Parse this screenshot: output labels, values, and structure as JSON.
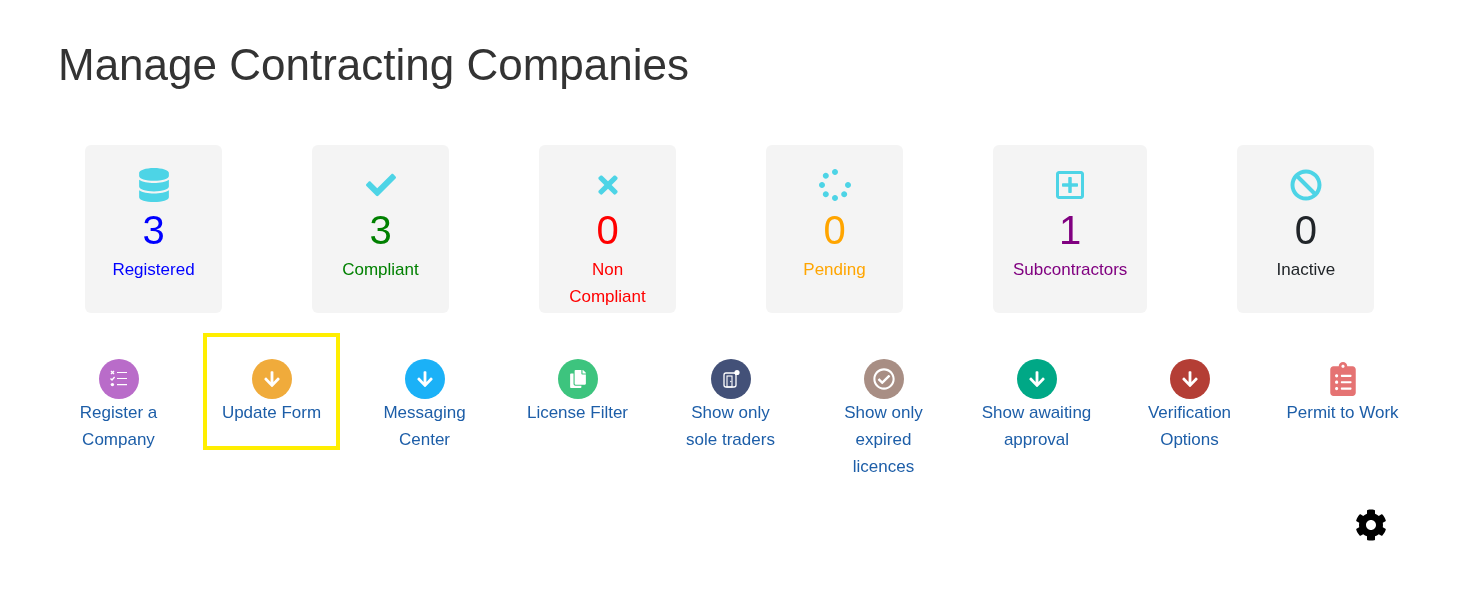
{
  "page": {
    "title": "Manage Contracting Companies"
  },
  "stats": [
    {
      "value": "3",
      "label": "Registered",
      "color": "#0000ff"
    },
    {
      "value": "3",
      "label": "Compliant",
      "color": "#008000"
    },
    {
      "value": "0",
      "label": "Non Compliant",
      "color": "#ff0000"
    },
    {
      "value": "0",
      "label": "Pending",
      "color": "#ffa500"
    },
    {
      "value": "1",
      "label": "Subcontractors",
      "color": "#800080"
    },
    {
      "value": "0",
      "label": "Inactive",
      "color": "#212529"
    }
  ],
  "actions": [
    {
      "label": "Register a\nCompany",
      "color": "#b96cc9",
      "highlighted": false
    },
    {
      "label": "Update Form",
      "color": "#f0ab3b",
      "highlighted": true
    },
    {
      "label": "Messaging\nCenter",
      "color": "#1bb1f7",
      "highlighted": false
    },
    {
      "label": "License Filter",
      "color": "#3dc47e",
      "highlighted": false
    },
    {
      "label": "Show only\nsole traders",
      "color": "#435178",
      "highlighted": false
    },
    {
      "label": "Show only\nexpired\nlicences",
      "color": "#a88e84",
      "highlighted": false
    },
    {
      "label": "Show awaiting\napproval",
      "color": "#00a886",
      "highlighted": false
    },
    {
      "label": "Verification\nOptions",
      "color": "#b43e35",
      "highlighted": false
    },
    {
      "label": "Permit to Work",
      "color": "#e57373",
      "highlighted": false
    }
  ]
}
